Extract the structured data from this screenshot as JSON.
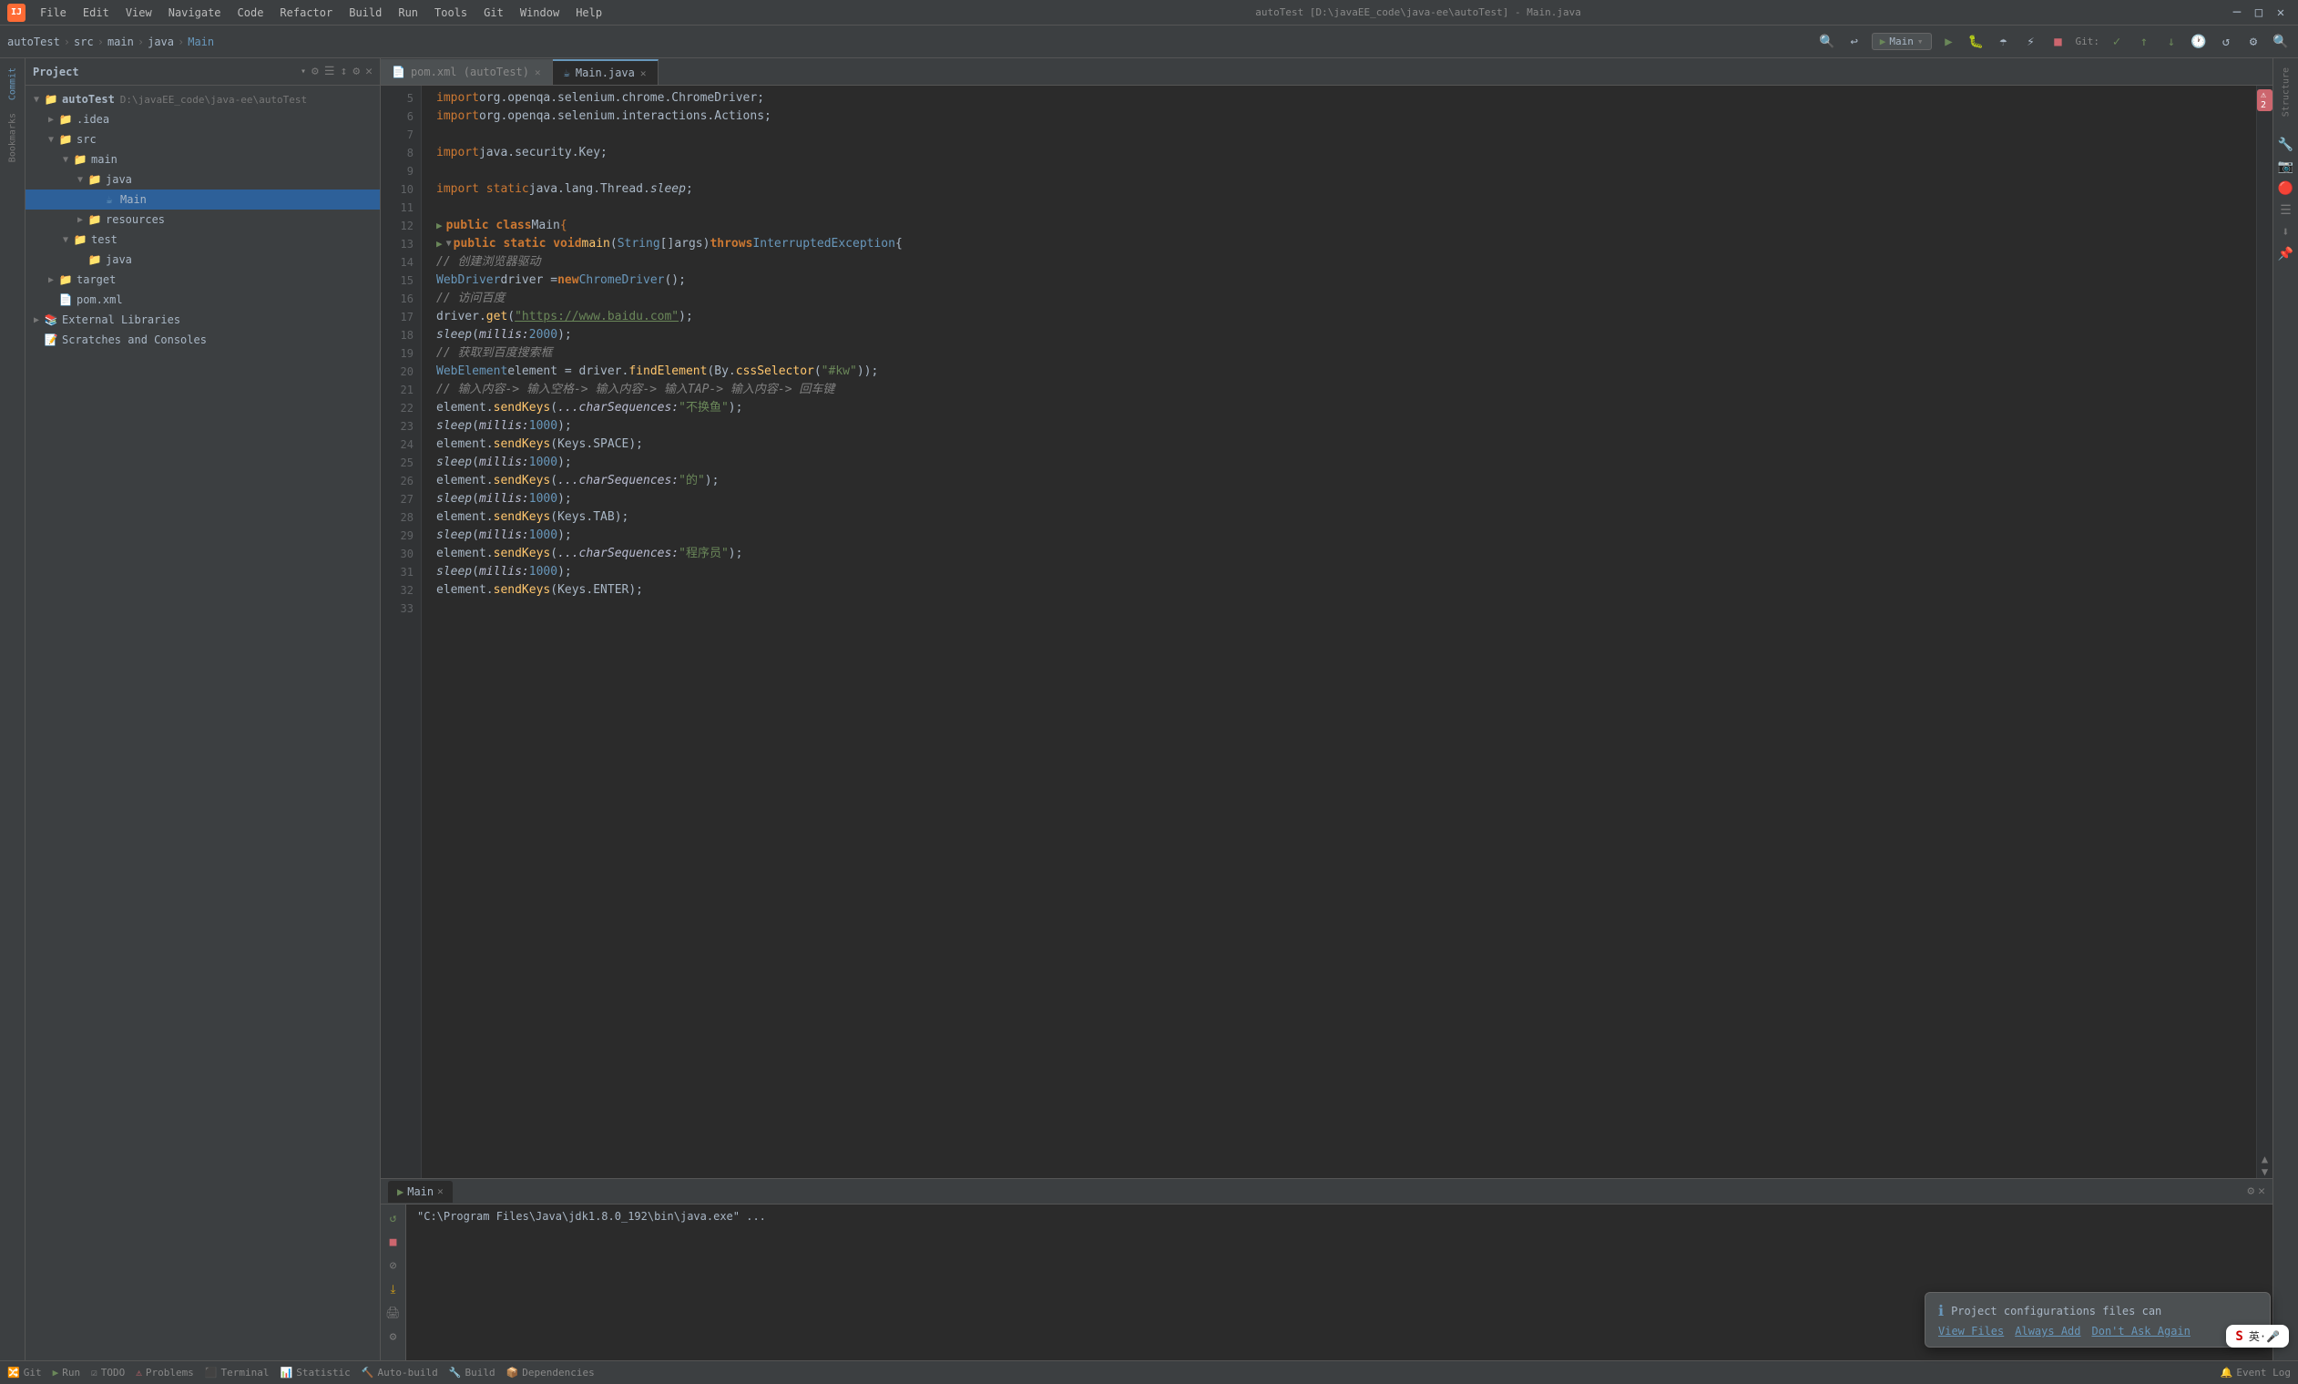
{
  "app": {
    "title": "autoTest [D:\\javaEE_code\\java-ee\\autoTest] - Main.java",
    "logo": "IJ"
  },
  "menu": {
    "items": [
      "File",
      "Edit",
      "View",
      "Navigate",
      "Code",
      "Refactor",
      "Build",
      "Run",
      "Tools",
      "Git",
      "Window",
      "Help"
    ]
  },
  "toolbar": {
    "breadcrumb": [
      "autoTest",
      "src",
      "main",
      "java",
      "Main"
    ],
    "run_config": "Main",
    "git_label": "Git:"
  },
  "project_panel": {
    "title": "Project",
    "items": [
      {
        "label": "autoTest",
        "path": "D:\\javaEE_code\\java-ee\\autoTest",
        "level": 0,
        "type": "project",
        "expanded": true
      },
      {
        "label": ".idea",
        "level": 1,
        "type": "folder",
        "expanded": false
      },
      {
        "label": "src",
        "level": 1,
        "type": "folder",
        "expanded": true
      },
      {
        "label": "main",
        "level": 2,
        "type": "folder",
        "expanded": true
      },
      {
        "label": "java",
        "level": 3,
        "type": "folder",
        "expanded": true
      },
      {
        "label": "Main",
        "level": 4,
        "type": "java",
        "expanded": false,
        "selected": true
      },
      {
        "label": "resources",
        "level": 3,
        "type": "folder",
        "expanded": false
      },
      {
        "label": "test",
        "level": 2,
        "type": "folder",
        "expanded": false
      },
      {
        "label": "java",
        "level": 3,
        "type": "folder",
        "expanded": false
      },
      {
        "label": "target",
        "level": 1,
        "type": "folder",
        "expanded": false
      },
      {
        "label": "pom.xml",
        "level": 1,
        "type": "xml"
      },
      {
        "label": "External Libraries",
        "level": 0,
        "type": "library",
        "expanded": false
      },
      {
        "label": "Scratches and Consoles",
        "level": 0,
        "type": "scratches"
      }
    ]
  },
  "tabs": [
    {
      "label": "pom.xml (autoTest)",
      "active": false,
      "icon": "xml"
    },
    {
      "label": "Main.java",
      "active": true,
      "icon": "java"
    }
  ],
  "code": {
    "lines": [
      {
        "num": 5,
        "content": "import org.openqa.selenium.chrome.ChromeDriver;",
        "type": "import"
      },
      {
        "num": 6,
        "content": "import org.openqa.selenium.interactions.Actions;",
        "type": "import"
      },
      {
        "num": 7,
        "content": "",
        "type": "empty"
      },
      {
        "num": 8,
        "content": "import java.security.Key;",
        "type": "import"
      },
      {
        "num": 9,
        "content": "",
        "type": "empty"
      },
      {
        "num": 10,
        "content": "import static java.lang.Thread.sleep;",
        "type": "import"
      },
      {
        "num": 11,
        "content": "",
        "type": "empty"
      },
      {
        "num": 12,
        "content": "public class Main {",
        "type": "class",
        "has_run": true
      },
      {
        "num": 13,
        "content": "    public static void main(String[] args) throws InterruptedException {",
        "type": "method",
        "has_run": true,
        "has_fold": true
      },
      {
        "num": 14,
        "content": "        // 创建浏览器驱动",
        "type": "comment"
      },
      {
        "num": 15,
        "content": "        WebDriver driver = new ChromeDriver();",
        "type": "code"
      },
      {
        "num": 16,
        "content": "        // 访问百度",
        "type": "comment"
      },
      {
        "num": 17,
        "content": "        driver.get(\"https://www.baidu.com\");",
        "type": "code"
      },
      {
        "num": 18,
        "content": "        sleep( millis: 2000);",
        "type": "code"
      },
      {
        "num": 19,
        "content": "        // 获取到百度搜索框",
        "type": "comment"
      },
      {
        "num": 20,
        "content": "        WebElement element = driver.findElement(By.cssSelector(\"#kw\"));",
        "type": "code"
      },
      {
        "num": 21,
        "content": "        // 输入内容-> 输入空格-> 输入内容-> 输入TAP-> 输入内容-> 回车键",
        "type": "comment"
      },
      {
        "num": 22,
        "content": "        element.sendKeys( ...charSequences: \"不换鱼\");",
        "type": "code"
      },
      {
        "num": 23,
        "content": "        sleep( millis: 1000);",
        "type": "code"
      },
      {
        "num": 24,
        "content": "        element.sendKeys(Keys.SPACE);",
        "type": "code"
      },
      {
        "num": 25,
        "content": "        sleep( millis: 1000);",
        "type": "code"
      },
      {
        "num": 26,
        "content": "        element.sendKeys( ...charSequences: \"的\");",
        "type": "code"
      },
      {
        "num": 27,
        "content": "        sleep( millis: 1000);",
        "type": "code"
      },
      {
        "num": 28,
        "content": "        element.sendKeys(Keys.TAB);",
        "type": "code"
      },
      {
        "num": 29,
        "content": "        sleep( millis: 1000);",
        "type": "code"
      },
      {
        "num": 30,
        "content": "        element.sendKeys( ...charSequences: \"程序员\");",
        "type": "code"
      },
      {
        "num": 31,
        "content": "        sleep( millis: 1000);",
        "type": "code"
      },
      {
        "num": 32,
        "content": "        element.sendKeys(Keys.ENTER);",
        "type": "code"
      },
      {
        "num": 33,
        "content": "",
        "type": "empty"
      }
    ]
  },
  "run_panel": {
    "tab": "Main",
    "output": "\"C:\\Program Files\\Java\\jdk1.8.0_192\\bin\\java.exe\" ..."
  },
  "status_bar": {
    "items": [
      "Git",
      "Run",
      "TODO",
      "Problems",
      "Terminal",
      "Statistic",
      "Auto-build",
      "Build",
      "Dependencies"
    ],
    "event_log": "Event Log"
  },
  "notification": {
    "icon": "ℹ",
    "text": "Project configurations files can",
    "actions": [
      "View Files",
      "Always Add",
      "Don't Ask Again"
    ]
  }
}
